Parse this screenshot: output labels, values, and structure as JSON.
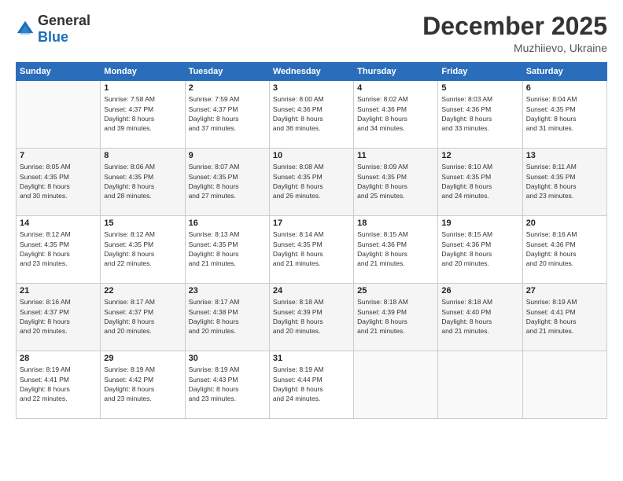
{
  "logo": {
    "general": "General",
    "blue": "Blue"
  },
  "title": "December 2025",
  "location": "Muzhiievo, Ukraine",
  "header_days": [
    "Sunday",
    "Monday",
    "Tuesday",
    "Wednesday",
    "Thursday",
    "Friday",
    "Saturday"
  ],
  "weeks": [
    [
      {
        "num": "",
        "info": ""
      },
      {
        "num": "1",
        "info": "Sunrise: 7:58 AM\nSunset: 4:37 PM\nDaylight: 8 hours\nand 39 minutes."
      },
      {
        "num": "2",
        "info": "Sunrise: 7:59 AM\nSunset: 4:37 PM\nDaylight: 8 hours\nand 37 minutes."
      },
      {
        "num": "3",
        "info": "Sunrise: 8:00 AM\nSunset: 4:36 PM\nDaylight: 8 hours\nand 36 minutes."
      },
      {
        "num": "4",
        "info": "Sunrise: 8:02 AM\nSunset: 4:36 PM\nDaylight: 8 hours\nand 34 minutes."
      },
      {
        "num": "5",
        "info": "Sunrise: 8:03 AM\nSunset: 4:36 PM\nDaylight: 8 hours\nand 33 minutes."
      },
      {
        "num": "6",
        "info": "Sunrise: 8:04 AM\nSunset: 4:35 PM\nDaylight: 8 hours\nand 31 minutes."
      }
    ],
    [
      {
        "num": "7",
        "info": "Sunrise: 8:05 AM\nSunset: 4:35 PM\nDaylight: 8 hours\nand 30 minutes."
      },
      {
        "num": "8",
        "info": "Sunrise: 8:06 AM\nSunset: 4:35 PM\nDaylight: 8 hours\nand 28 minutes."
      },
      {
        "num": "9",
        "info": "Sunrise: 8:07 AM\nSunset: 4:35 PM\nDaylight: 8 hours\nand 27 minutes."
      },
      {
        "num": "10",
        "info": "Sunrise: 8:08 AM\nSunset: 4:35 PM\nDaylight: 8 hours\nand 26 minutes."
      },
      {
        "num": "11",
        "info": "Sunrise: 8:09 AM\nSunset: 4:35 PM\nDaylight: 8 hours\nand 25 minutes."
      },
      {
        "num": "12",
        "info": "Sunrise: 8:10 AM\nSunset: 4:35 PM\nDaylight: 8 hours\nand 24 minutes."
      },
      {
        "num": "13",
        "info": "Sunrise: 8:11 AM\nSunset: 4:35 PM\nDaylight: 8 hours\nand 23 minutes."
      }
    ],
    [
      {
        "num": "14",
        "info": "Sunrise: 8:12 AM\nSunset: 4:35 PM\nDaylight: 8 hours\nand 23 minutes."
      },
      {
        "num": "15",
        "info": "Sunrise: 8:12 AM\nSunset: 4:35 PM\nDaylight: 8 hours\nand 22 minutes."
      },
      {
        "num": "16",
        "info": "Sunrise: 8:13 AM\nSunset: 4:35 PM\nDaylight: 8 hours\nand 21 minutes."
      },
      {
        "num": "17",
        "info": "Sunrise: 8:14 AM\nSunset: 4:35 PM\nDaylight: 8 hours\nand 21 minutes."
      },
      {
        "num": "18",
        "info": "Sunrise: 8:15 AM\nSunset: 4:36 PM\nDaylight: 8 hours\nand 21 minutes."
      },
      {
        "num": "19",
        "info": "Sunrise: 8:15 AM\nSunset: 4:36 PM\nDaylight: 8 hours\nand 20 minutes."
      },
      {
        "num": "20",
        "info": "Sunrise: 8:16 AM\nSunset: 4:36 PM\nDaylight: 8 hours\nand 20 minutes."
      }
    ],
    [
      {
        "num": "21",
        "info": "Sunrise: 8:16 AM\nSunset: 4:37 PM\nDaylight: 8 hours\nand 20 minutes."
      },
      {
        "num": "22",
        "info": "Sunrise: 8:17 AM\nSunset: 4:37 PM\nDaylight: 8 hours\nand 20 minutes."
      },
      {
        "num": "23",
        "info": "Sunrise: 8:17 AM\nSunset: 4:38 PM\nDaylight: 8 hours\nand 20 minutes."
      },
      {
        "num": "24",
        "info": "Sunrise: 8:18 AM\nSunset: 4:39 PM\nDaylight: 8 hours\nand 20 minutes."
      },
      {
        "num": "25",
        "info": "Sunrise: 8:18 AM\nSunset: 4:39 PM\nDaylight: 8 hours\nand 21 minutes."
      },
      {
        "num": "26",
        "info": "Sunrise: 8:18 AM\nSunset: 4:40 PM\nDaylight: 8 hours\nand 21 minutes."
      },
      {
        "num": "27",
        "info": "Sunrise: 8:19 AM\nSunset: 4:41 PM\nDaylight: 8 hours\nand 21 minutes."
      }
    ],
    [
      {
        "num": "28",
        "info": "Sunrise: 8:19 AM\nSunset: 4:41 PM\nDaylight: 8 hours\nand 22 minutes."
      },
      {
        "num": "29",
        "info": "Sunrise: 8:19 AM\nSunset: 4:42 PM\nDaylight: 8 hours\nand 23 minutes."
      },
      {
        "num": "30",
        "info": "Sunrise: 8:19 AM\nSunset: 4:43 PM\nDaylight: 8 hours\nand 23 minutes."
      },
      {
        "num": "31",
        "info": "Sunrise: 8:19 AM\nSunset: 4:44 PM\nDaylight: 8 hours\nand 24 minutes."
      },
      {
        "num": "",
        "info": ""
      },
      {
        "num": "",
        "info": ""
      },
      {
        "num": "",
        "info": ""
      }
    ]
  ]
}
